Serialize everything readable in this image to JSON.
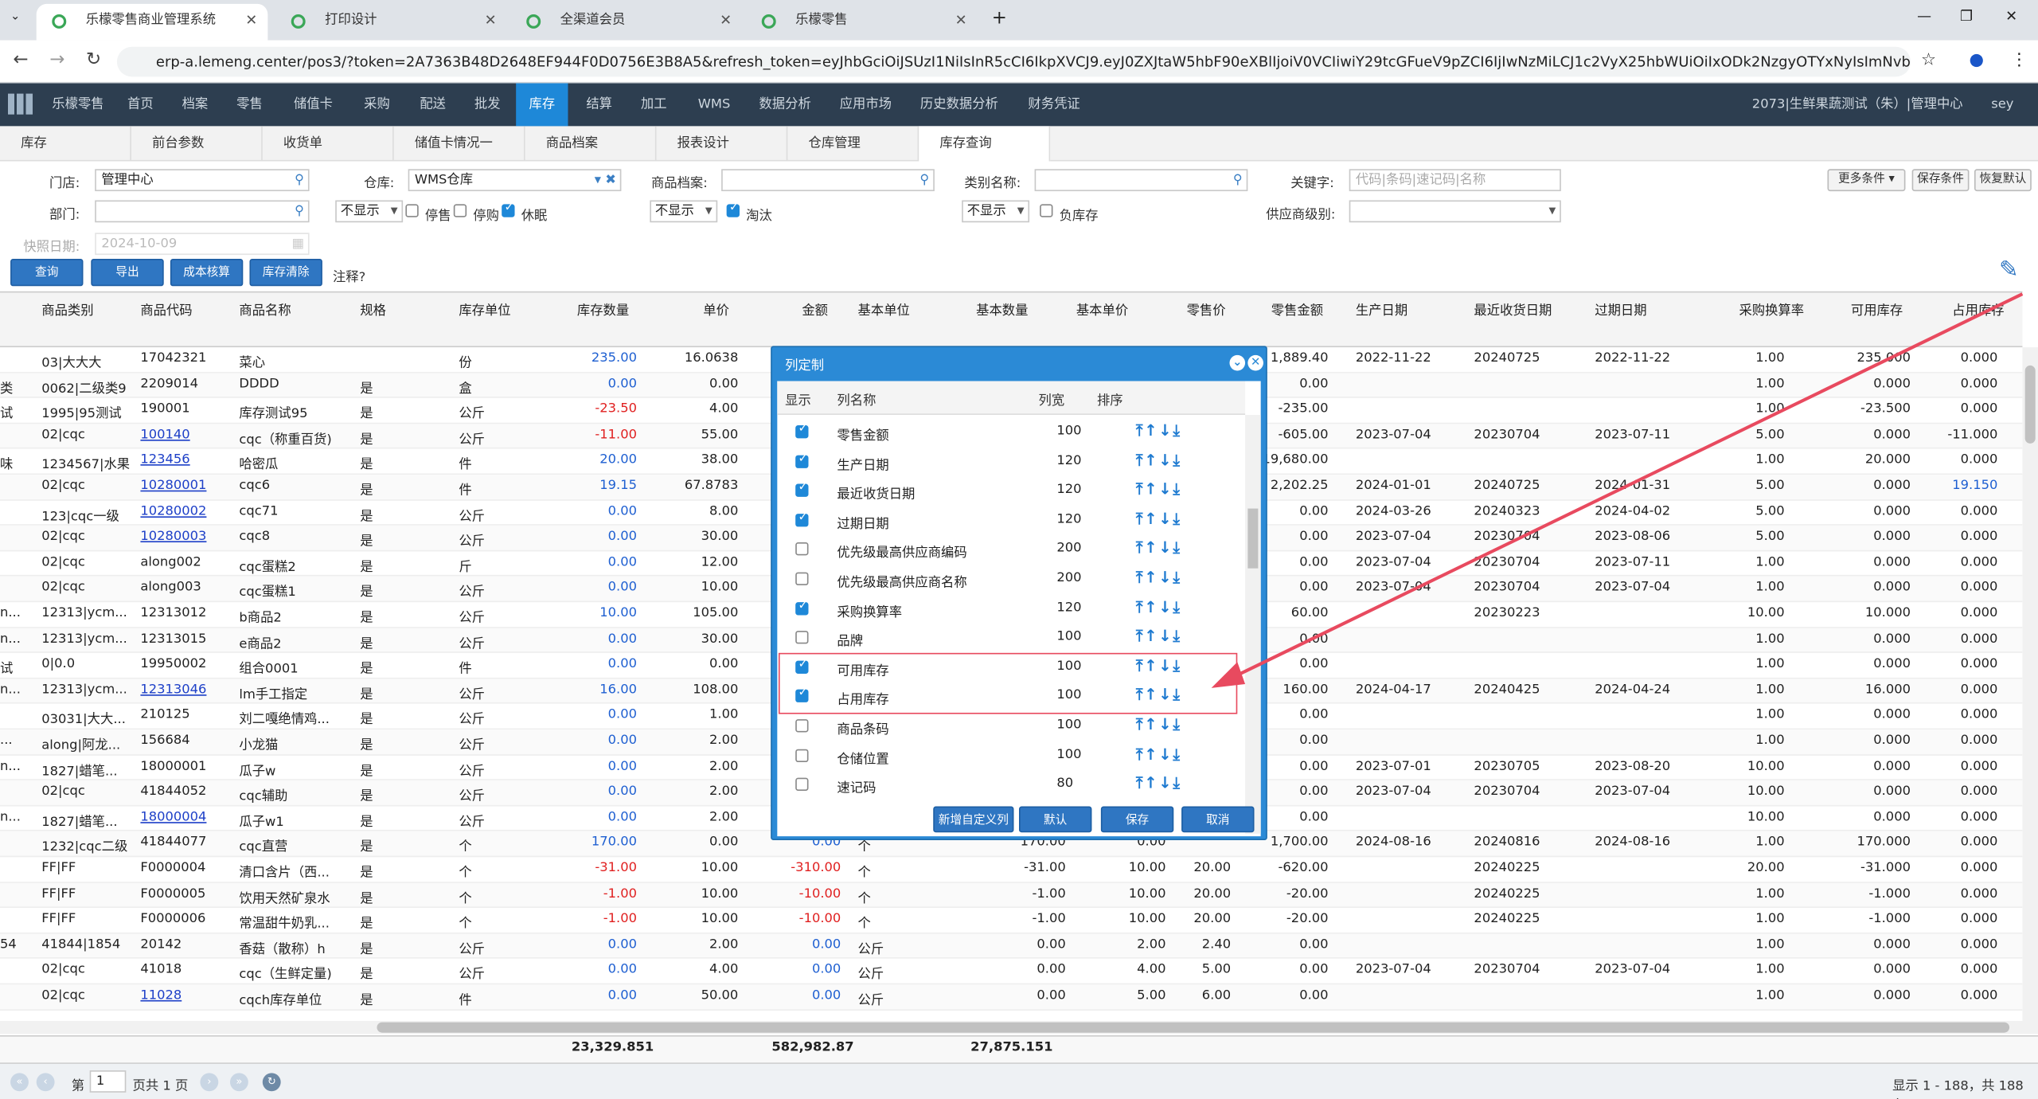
{
  "browser": {
    "tabs": [
      "乐檬零售商业管理系统",
      "打印设计",
      "全渠道会员",
      "乐檬零售"
    ],
    "new_tab": "+",
    "url": "erp-a.lemeng.center/pos3/?token=2A7363B48D2648EF944F0D0756E3B8A5&refresh_token=eyJhbGciOiJSUzI1NiIsInR5cCI6IkpXVCJ9.eyJ0ZXJtaW5hbF90eXBlIjoiV0VCIiwiY29tcGFueV9pZCI6IjIwNzMiLCJ1c2VyX25hbWUiOiIxODk2NzgyOTYxNyIsImNvbXBhbnlfdXNlcl..."
  },
  "appnav": {
    "items": [
      "乐檬零售",
      "首页",
      "档案",
      "零售",
      "储值卡",
      "采购",
      "配送",
      "批发",
      "库存",
      "结算",
      "加工",
      "WMS",
      "数据分析",
      "应用市场",
      "历史数据分析",
      "财务凭证"
    ],
    "right": "2073|生鲜果蔬测试（朱）|管理中心",
    "user": "sey"
  },
  "subtabs": [
    "库存",
    "前台参数",
    "收货单",
    "储值卡情况一览",
    "商品档案",
    "报表设计",
    "仓库管理",
    "库存查询"
  ],
  "filters": {
    "store_label": "门店:",
    "store_value": "管理中心",
    "warehouse_label": "仓库:",
    "warehouse_value": "WMS仓库",
    "goods_label": "商品档案:",
    "category_label": "类别名称:",
    "keyword_label": "关键字:",
    "keyword_placeholder": "代码|条码|速记码|名称",
    "dept_label": "部门:",
    "hide1": "不显示",
    "stop_sale": "停售",
    "stop_buy": "停购",
    "dormant": "休眠",
    "hide2": "不显示",
    "eliminate": "淘汰",
    "hide3": "不显示",
    "negative": "负库存",
    "supplier_label": "供应商级别:",
    "snapshot_label": "快照日期:",
    "snapshot_value": "2024-10-09",
    "more": "更多条件",
    "save_cond": "保存条件",
    "reset": "恢复默认",
    "note": "注释?"
  },
  "buttons": [
    "查询",
    "导出",
    "成本核算",
    "库存清除"
  ],
  "columns": [
    "商品类别",
    "商品代码",
    "商品名称",
    "规格",
    "库存单位",
    "库存数量",
    "单价",
    "金额",
    "基本单位",
    "基本数量",
    "基本单价",
    "零售价",
    "零售金额",
    "生产日期",
    "最近收货日期",
    "过期日期",
    "采购换算率",
    "可用库存",
    "占用库存"
  ],
  "rows": [
    [
      "03|大大大",
      "17042321",
      "菜心",
      "",
      "份",
      "235.00",
      "16.0638",
      "",
      "",
      "",
      "",
      "",
      "1,889.40",
      "2022-11-22",
      "20240725",
      "2022-11-22",
      "1.00",
      "235.000",
      "0.000"
    ],
    [
      "0062|二级类9",
      "2209014",
      "DDDD",
      "是",
      "盒",
      "0.00",
      "0.00",
      "",
      "",
      "",
      "",
      "",
      "0.00",
      "",
      "",
      "",
      "1.00",
      "0.000",
      "0.000"
    ],
    [
      "1995|95测试",
      "190001",
      "库存测试95",
      "是",
      "公斤",
      "-23.50",
      "4.00",
      "",
      "",
      "",
      "",
      "",
      "-235.00",
      "",
      "",
      "",
      "1.00",
      "-23.500",
      "0.000"
    ],
    [
      "02|cqc",
      "100140",
      "cqc（称重百货)",
      "是",
      "公斤",
      "-11.00",
      "55.00",
      "",
      "",
      "",
      "",
      "",
      "-605.00",
      "2023-07-04",
      "20230704",
      "2023-07-11",
      "5.00",
      "0.000",
      "-11.000"
    ],
    [
      "1234567|水果",
      "123456",
      "哈密瓜",
      "是",
      "件",
      "20.00",
      "38.00",
      "",
      "",
      "",
      "",
      "",
      "19,680.00",
      "",
      "",
      "",
      "1.00",
      "20.000",
      "0.000"
    ],
    [
      "02|cqc",
      "10280001",
      "cqc6",
      "是",
      "件",
      "19.15",
      "67.8783",
      "",
      "",
      "",
      "",
      "",
      "2,202.25",
      "2024-01-01",
      "20240725",
      "2024-01-31",
      "5.00",
      "0.000",
      "19.150"
    ],
    [
      "123|cqc一级",
      "10280002",
      "cqc71",
      "是",
      "公斤",
      "0.00",
      "8.00",
      "",
      "",
      "",
      "",
      "",
      "0.00",
      "2024-03-26",
      "20240323",
      "2024-04-02",
      "5.00",
      "0.000",
      "0.000"
    ],
    [
      "02|cqc",
      "10280003",
      "cqc8",
      "是",
      "公斤",
      "0.00",
      "30.00",
      "",
      "",
      "",
      "",
      "",
      "0.00",
      "2023-07-04",
      "20230704",
      "2023-08-06",
      "5.00",
      "0.000",
      "0.000"
    ],
    [
      "02|cqc",
      "along002",
      "cqc蛋糕2",
      "是",
      "斤",
      "0.00",
      "12.00",
      "",
      "",
      "",
      "",
      "",
      "0.00",
      "2023-07-04",
      "20230704",
      "2023-07-11",
      "1.00",
      "0.000",
      "0.000"
    ],
    [
      "02|cqc",
      "along003",
      "cqc蛋糕1",
      "是",
      "公斤",
      "0.00",
      "10.00",
      "",
      "",
      "",
      "",
      "",
      "0.00",
      "2023-07-04",
      "20230704",
      "2023-07-04",
      "1.00",
      "0.000",
      "0.000"
    ],
    [
      "12313|ycm...",
      "12313012",
      "b商品2",
      "是",
      "公斤",
      "10.00",
      "105.00",
      "",
      "",
      "",
      "",
      "",
      "60.00",
      "",
      "20230223",
      "",
      "10.00",
      "10.000",
      "0.000"
    ],
    [
      "12313|ycm...",
      "12313015",
      "e商品2",
      "是",
      "公斤",
      "0.00",
      "30.00",
      "",
      "",
      "",
      "",
      "",
      "0.00",
      "",
      "",
      "",
      "1.00",
      "0.000",
      "0.000"
    ],
    [
      "0|0.0",
      "19950002",
      "组合0001",
      "是",
      "件",
      "0.00",
      "0.00",
      "",
      "",
      "",
      "",
      "",
      "0.00",
      "",
      "",
      "",
      "1.00",
      "0.000",
      "0.000"
    ],
    [
      "12313|ycm...",
      "12313046",
      "lm手工指定",
      "是",
      "公斤",
      "16.00",
      "108.00",
      "",
      "",
      "",
      "",
      "",
      "160.00",
      "2024-04-17",
      "20240425",
      "2024-04-24",
      "1.00",
      "16.000",
      "0.000"
    ],
    [
      "03031|大大...",
      "210125",
      "刘二嘎绝情鸡...",
      "是",
      "公斤",
      "0.00",
      "1.00",
      "",
      "",
      "",
      "",
      "",
      "0.00",
      "",
      "",
      "",
      "1.00",
      "0.000",
      "0.000"
    ],
    [
      "along|阿龙...",
      "156684",
      "小龙猫",
      "是",
      "公斤",
      "0.00",
      "2.00",
      "",
      "",
      "",
      "",
      "",
      "0.00",
      "",
      "",
      "",
      "1.00",
      "0.000",
      "0.000"
    ],
    [
      "1827|蜡笔...",
      "18000001",
      "瓜子w",
      "是",
      "公斤",
      "0.00",
      "2.00",
      "",
      "",
      "",
      "",
      "",
      "0.00",
      "2023-07-01",
      "20230705",
      "2023-08-20",
      "10.00",
      "0.000",
      "0.000"
    ],
    [
      "02|cqc",
      "41844052",
      "cqc辅助",
      "是",
      "公斤",
      "0.00",
      "2.00",
      "",
      "",
      "",
      "",
      "",
      "0.00",
      "2023-07-04",
      "20230704",
      "2023-07-04",
      "10.00",
      "0.000",
      "0.000"
    ],
    [
      "1827|蜡笔...",
      "18000004",
      "瓜子w1",
      "是",
      "公斤",
      "0.00",
      "2.00",
      "",
      "",
      "",
      "",
      "",
      "0.00",
      "",
      "",
      "",
      "10.00",
      "0.000",
      "0.000"
    ],
    [
      "1232|cqc二级",
      "41844077",
      "cqc直营",
      "是",
      "个",
      "170.00",
      "0.00",
      "0.00",
      "个",
      "170.00",
      "0.00",
      "",
      "1,700.00",
      "2024-08-16",
      "20240816",
      "2024-08-16",
      "1.00",
      "170.000",
      "0.000"
    ],
    [
      "FF|FF",
      "F0000004",
      "清口含片（西...",
      "是",
      "个",
      "-31.00",
      "10.00",
      "-310.00",
      "个",
      "-31.00",
      "10.00",
      "20.00",
      "-620.00",
      "",
      "20240225",
      "",
      "20.00",
      "-31.000",
      "0.000"
    ],
    [
      "FF|FF",
      "F0000005",
      "饮用天然矿泉水",
      "是",
      "个",
      "-1.00",
      "10.00",
      "-10.00",
      "个",
      "-1.00",
      "10.00",
      "20.00",
      "-20.00",
      "",
      "20240225",
      "",
      "1.00",
      "-1.000",
      "0.000"
    ],
    [
      "FF|FF",
      "F0000006",
      "常温甜牛奶乳...",
      "是",
      "个",
      "-1.00",
      "10.00",
      "-10.00",
      "个",
      "-1.00",
      "10.00",
      "20.00",
      "-20.00",
      "",
      "20240225",
      "",
      "1.00",
      "-1.000",
      "0.000"
    ],
    [
      "41844|1854",
      "20142",
      "香菇（散称）h",
      "是",
      "公斤",
      "0.00",
      "2.00",
      "0.00",
      "公斤",
      "0.00",
      "2.00",
      "2.40",
      "0.00",
      "",
      "",
      "",
      "1.00",
      "0.000",
      "0.000"
    ],
    [
      "02|cqc",
      "41018",
      "cqc（生鲜定量)",
      "是",
      "公斤",
      "0.00",
      "4.00",
      "0.00",
      "公斤",
      "0.00",
      "4.00",
      "5.00",
      "0.00",
      "2023-07-04",
      "20230704",
      "2023-07-04",
      "1.00",
      "0.000",
      "0.000"
    ],
    [
      "02|cqc",
      "11028",
      "cqch库存单位",
      "是",
      "件",
      "0.00",
      "50.00",
      "0.00",
      "公斤",
      "0.00",
      "5.00",
      "6.00",
      "0.00",
      "",
      "",
      "",
      "1.00",
      "0.000",
      "0.000"
    ]
  ],
  "left_clip": [
    "",
    "类",
    "试",
    "",
    "味",
    "",
    "",
    "",
    "",
    "",
    "n...",
    "n...",
    "试",
    "n...",
    "",
    "...",
    "n...",
    "",
    "n...",
    "",
    "",
    "",
    "",
    "54",
    "",
    ""
  ],
  "totals": {
    "qty": "23,329.851",
    "amount": "582,982.87",
    "retail": "27,875.151"
  },
  "pager": {
    "page_label": "第",
    "page": "1",
    "total": "页共 1 页",
    "summary": "显示 1 - 188，共 188 条"
  },
  "dialog": {
    "title": "列定制",
    "headers": [
      "显示",
      "列名称",
      "列宽",
      "排序"
    ],
    "rows": [
      {
        "name": "零售金额",
        "width": "100",
        "checked": true
      },
      {
        "name": "生产日期",
        "width": "120",
        "checked": true
      },
      {
        "name": "最近收货日期",
        "width": "120",
        "checked": true
      },
      {
        "name": "过期日期",
        "width": "120",
        "checked": true
      },
      {
        "name": "优先级最高供应商编码",
        "width": "200",
        "checked": false
      },
      {
        "name": "优先级最高供应商名称",
        "width": "200",
        "checked": false
      },
      {
        "name": "采购换算率",
        "width": "120",
        "checked": true
      },
      {
        "name": "品牌",
        "width": "100",
        "checked": false
      },
      {
        "name": "可用库存",
        "width": "100",
        "checked": true
      },
      {
        "name": "占用库存",
        "width": "100",
        "checked": true
      },
      {
        "name": "商品条码",
        "width": "100",
        "checked": false
      },
      {
        "name": "仓储位置",
        "width": "100",
        "checked": false
      },
      {
        "name": "速记码",
        "width": "80",
        "checked": false
      }
    ],
    "sort_icons": "⤒↑↓⤓",
    "buttons": [
      "新增自定义列",
      "默认",
      "保存",
      "取消"
    ]
  },
  "colors": {
    "accent": "#1e88d8",
    "nav_bg": "#2d3e50",
    "annotation": "#e84a5f"
  }
}
